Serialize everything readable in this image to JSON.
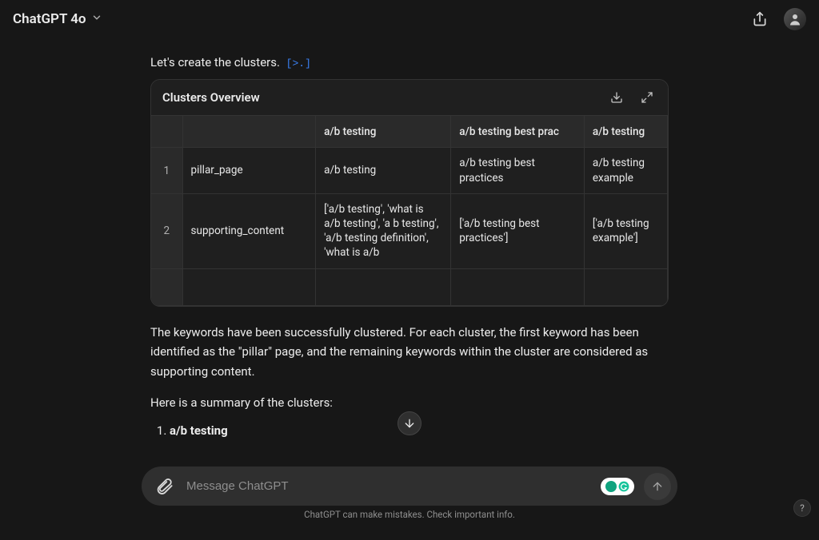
{
  "header": {
    "model_label": "ChatGPT 4o"
  },
  "message": {
    "intro": "Let's create the clusters.",
    "code_chip": "[>.]"
  },
  "card": {
    "title": "Clusters Overview",
    "columns": {
      "idx": "",
      "label": "",
      "c1": "a/b testing",
      "c2": "a/b testing best prac",
      "c3": "a/b testing"
    },
    "rows": [
      {
        "idx": "1",
        "label": "pillar_page",
        "c1": "a/b testing",
        "c2": "a/b testing best practices",
        "c3": "a/b testing example"
      },
      {
        "idx": "2",
        "label": "supporting_content",
        "c1": "['a/b testing', 'what is a/b testing', 'a b testing', 'a/b testing definition', 'what is a/b",
        "c2": "['a/b testing best practices']",
        "c3": "['a/b testing example']"
      }
    ]
  },
  "paragraphs": {
    "p1": "The keywords have been successfully clustered. For each cluster, the first keyword has been identified as the \"pillar\" page, and the remaining keywords within the cluster are considered as supporting content.",
    "p2": "Here is a summary of the clusters:"
  },
  "summary_list": {
    "item1": "a/b testing"
  },
  "input": {
    "placeholder": "Message ChatGPT"
  },
  "footnote": "ChatGPT can make mistakes. Check important info.",
  "help": "?"
}
